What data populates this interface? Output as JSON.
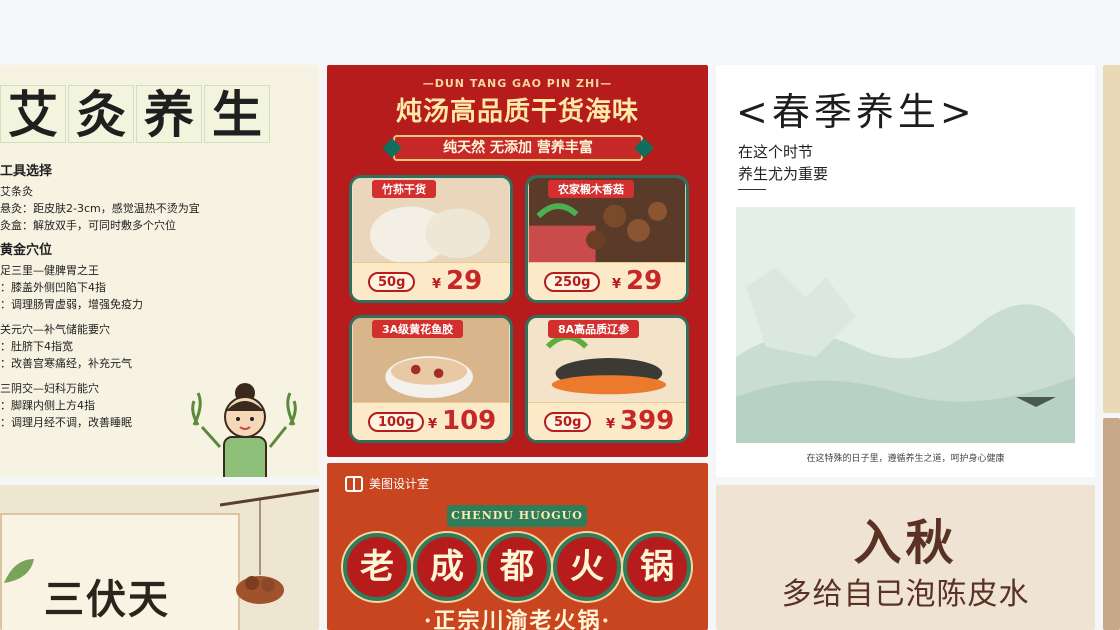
{
  "cards": {
    "moxibustion": {
      "title_chars": [
        "艾",
        "灸",
        "养",
        "生"
      ],
      "lines": [
        {
          "text": "工具选择",
          "heading": true
        },
        {
          "text": "艾条灸",
          "heading": false
        },
        {
          "text": "悬灸：距皮肤2-3cm，感觉温热不烫为宜",
          "heading": false
        },
        {
          "text": "灸盒：解放双手，可同时敷多个穴位",
          "heading": false
        },
        {
          "text": "黄金穴位",
          "heading": true
        },
        {
          "text": "足三里—健脾胃之王",
          "heading": false
        },
        {
          "text": "：膝盖外侧凹陷下4指",
          "heading": false
        },
        {
          "text": "：调理肠胃虚弱，增强免疫力",
          "heading": false
        },
        {
          "text": "",
          "heading": false
        },
        {
          "text": "关元穴—补气储能要穴",
          "heading": false
        },
        {
          "text": "：肚脐下4指宽",
          "heading": false
        },
        {
          "text": "：改善宫寒痛经，补充元气",
          "heading": false
        },
        {
          "text": "",
          "heading": false
        },
        {
          "text": "三阴交—妇科万能穴",
          "heading": false
        },
        {
          "text": "：脚踝内侧上方4指",
          "heading": false
        },
        {
          "text": "：调理月经不调，改善睡眠",
          "heading": false
        }
      ]
    },
    "soup": {
      "pinyin": "—DUN TANG GAO PIN ZHI—",
      "headline": "炖汤高品质干货海味",
      "ribbon": "纯天然 无添加 营养丰富",
      "products": [
        {
          "name": "竹荪干货",
          "weight": "50g",
          "currency": "¥",
          "price": "29"
        },
        {
          "name": "农家椴木香菇",
          "weight": "250g",
          "currency": "¥",
          "price": "29"
        },
        {
          "name": "3A级黄花鱼胶",
          "weight": "100g",
          "currency": "¥",
          "price": "109"
        },
        {
          "name": "8A高品质辽参",
          "weight": "50g",
          "currency": "¥",
          "price": "399"
        }
      ]
    },
    "spring": {
      "title": "<春季养生>",
      "sub1": "在这个时节",
      "sub2": "养生尤为重要",
      "caption": "在这特殊的日子里，遵循养生之道，呵护身心健康"
    },
    "sanfu": {
      "title": "三伏天"
    },
    "hotpot": {
      "brand": "美图设计室",
      "english": "CHENDU HUOGUO",
      "chars": [
        "老",
        "成",
        "都",
        "火",
        "锅"
      ],
      "bottom": "·正宗川渝老火锅·"
    },
    "autumn": {
      "title": "入秋",
      "sub": "多给自已泡陈皮水"
    }
  }
}
